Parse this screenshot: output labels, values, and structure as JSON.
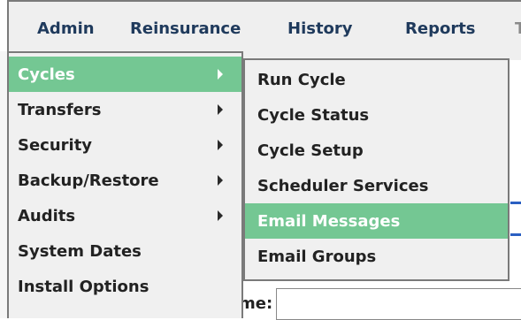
{
  "menubar": {
    "items": [
      "Admin",
      "Reinsurance",
      "History",
      "Reports",
      "T"
    ]
  },
  "admin_menu": {
    "items": [
      {
        "label": "Cycles",
        "submenu": true,
        "active": true
      },
      {
        "label": "Transfers",
        "submenu": true
      },
      {
        "label": "Security",
        "submenu": true
      },
      {
        "label": "Backup/Restore",
        "submenu": true
      },
      {
        "label": "Audits",
        "submenu": true
      },
      {
        "label": "System Dates",
        "submenu": false
      },
      {
        "label": "Install Options",
        "submenu": false
      }
    ]
  },
  "cycles_submenu": {
    "items": [
      {
        "label": "Run Cycle"
      },
      {
        "label": "Cycle Status"
      },
      {
        "label": "Cycle Setup"
      },
      {
        "label": "Scheduler Services"
      },
      {
        "label": "Email Messages",
        "active": true
      },
      {
        "label": "Email Groups"
      }
    ]
  },
  "background": {
    "field_label": "me:"
  },
  "colors": {
    "highlight": "#74c793",
    "menu_bg": "#f0f0f0",
    "menu_border": "#7a7a7a",
    "menubar_text": "#1f3a5c",
    "link": "#2b5fc2"
  },
  "icons": {
    "submenu": "chevron-right-icon"
  }
}
